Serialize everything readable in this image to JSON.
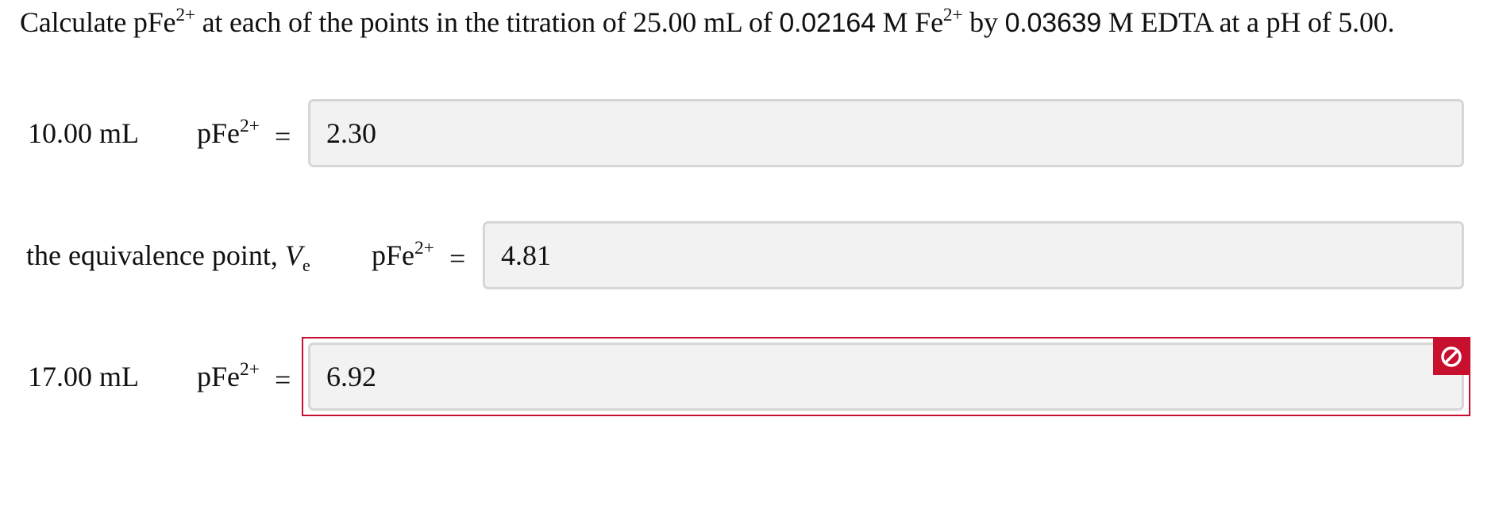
{
  "question": {
    "part1": "Calculate pFe",
    "charge1": "2+",
    "part2": " at each of the points in the titration of 25.00 mL of ",
    "conc1": "0.02164",
    "part3": " M Fe",
    "charge2": "2+",
    "part4": " by ",
    "conc2": "0.03639",
    "part5": " M EDTA at a pH of 5.00."
  },
  "rows": [
    {
      "volume_label": "10.00 mL",
      "quantity": "pFe",
      "charge": "2+",
      "equals": "=",
      "answer": "2.30",
      "status": "neutral"
    },
    {
      "volume_label_prefix": "the equivalence point, ",
      "volume_symbol": "V",
      "volume_subscript": "e",
      "quantity": "pFe",
      "charge": "2+",
      "equals": "=",
      "answer": "4.81",
      "status": "neutral"
    },
    {
      "volume_label": "17.00 mL",
      "quantity": "pFe",
      "charge": "2+",
      "equals": "=",
      "answer": "6.92",
      "status": "incorrect",
      "status_icon": "prohibited-icon"
    }
  ],
  "colors": {
    "error": "#c8102e",
    "field_bg": "#f2f2f2",
    "field_border": "#d6d6d6"
  }
}
